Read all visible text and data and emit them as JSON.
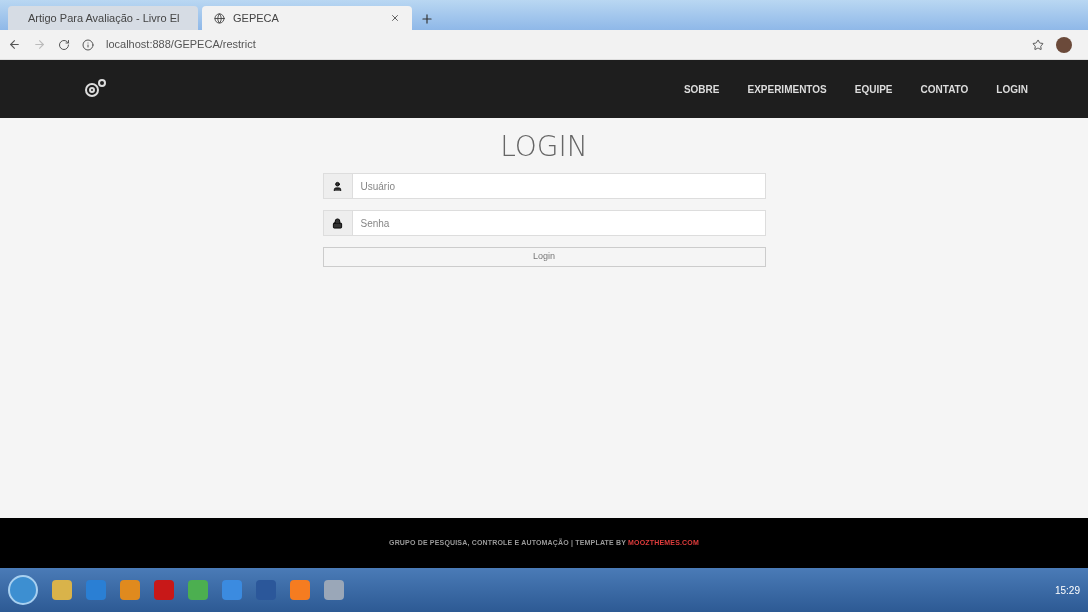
{
  "browser": {
    "tabs": [
      {
        "title": "Artigo Para Avaliação - Livro El",
        "selected": false
      },
      {
        "title": "GEPECA",
        "selected": true
      }
    ],
    "url": "localhost:888/GEPECA/restrict"
  },
  "nav": {
    "links": [
      "SOBRE",
      "EXPERIMENTOS",
      "EQUIPE",
      "CONTATO",
      "LOGIN"
    ]
  },
  "login": {
    "title": "LOGIN",
    "fields": [
      {
        "kind": "user",
        "placeholder": "Usuário"
      },
      {
        "kind": "password",
        "placeholder": "Senha"
      }
    ],
    "button": "Login"
  },
  "footer": {
    "text": "GRUPO DE PESQUISA, CONTROLE E AUTOMAÇÃO | TEMPLATE BY ",
    "link": "MOOZTHEMES.COM"
  },
  "taskbar": {
    "apps": [
      {
        "color": "#d9b34a"
      },
      {
        "color": "#2a7fd4"
      },
      {
        "color": "#e08a1e"
      },
      {
        "color": "#c81818"
      },
      {
        "color": "#4caf50"
      },
      {
        "color": "#3b8be0"
      },
      {
        "color": "#2b579a"
      },
      {
        "color": "#f57c20"
      },
      {
        "color": "#9aa7b8"
      }
    ],
    "time": "15:29"
  }
}
